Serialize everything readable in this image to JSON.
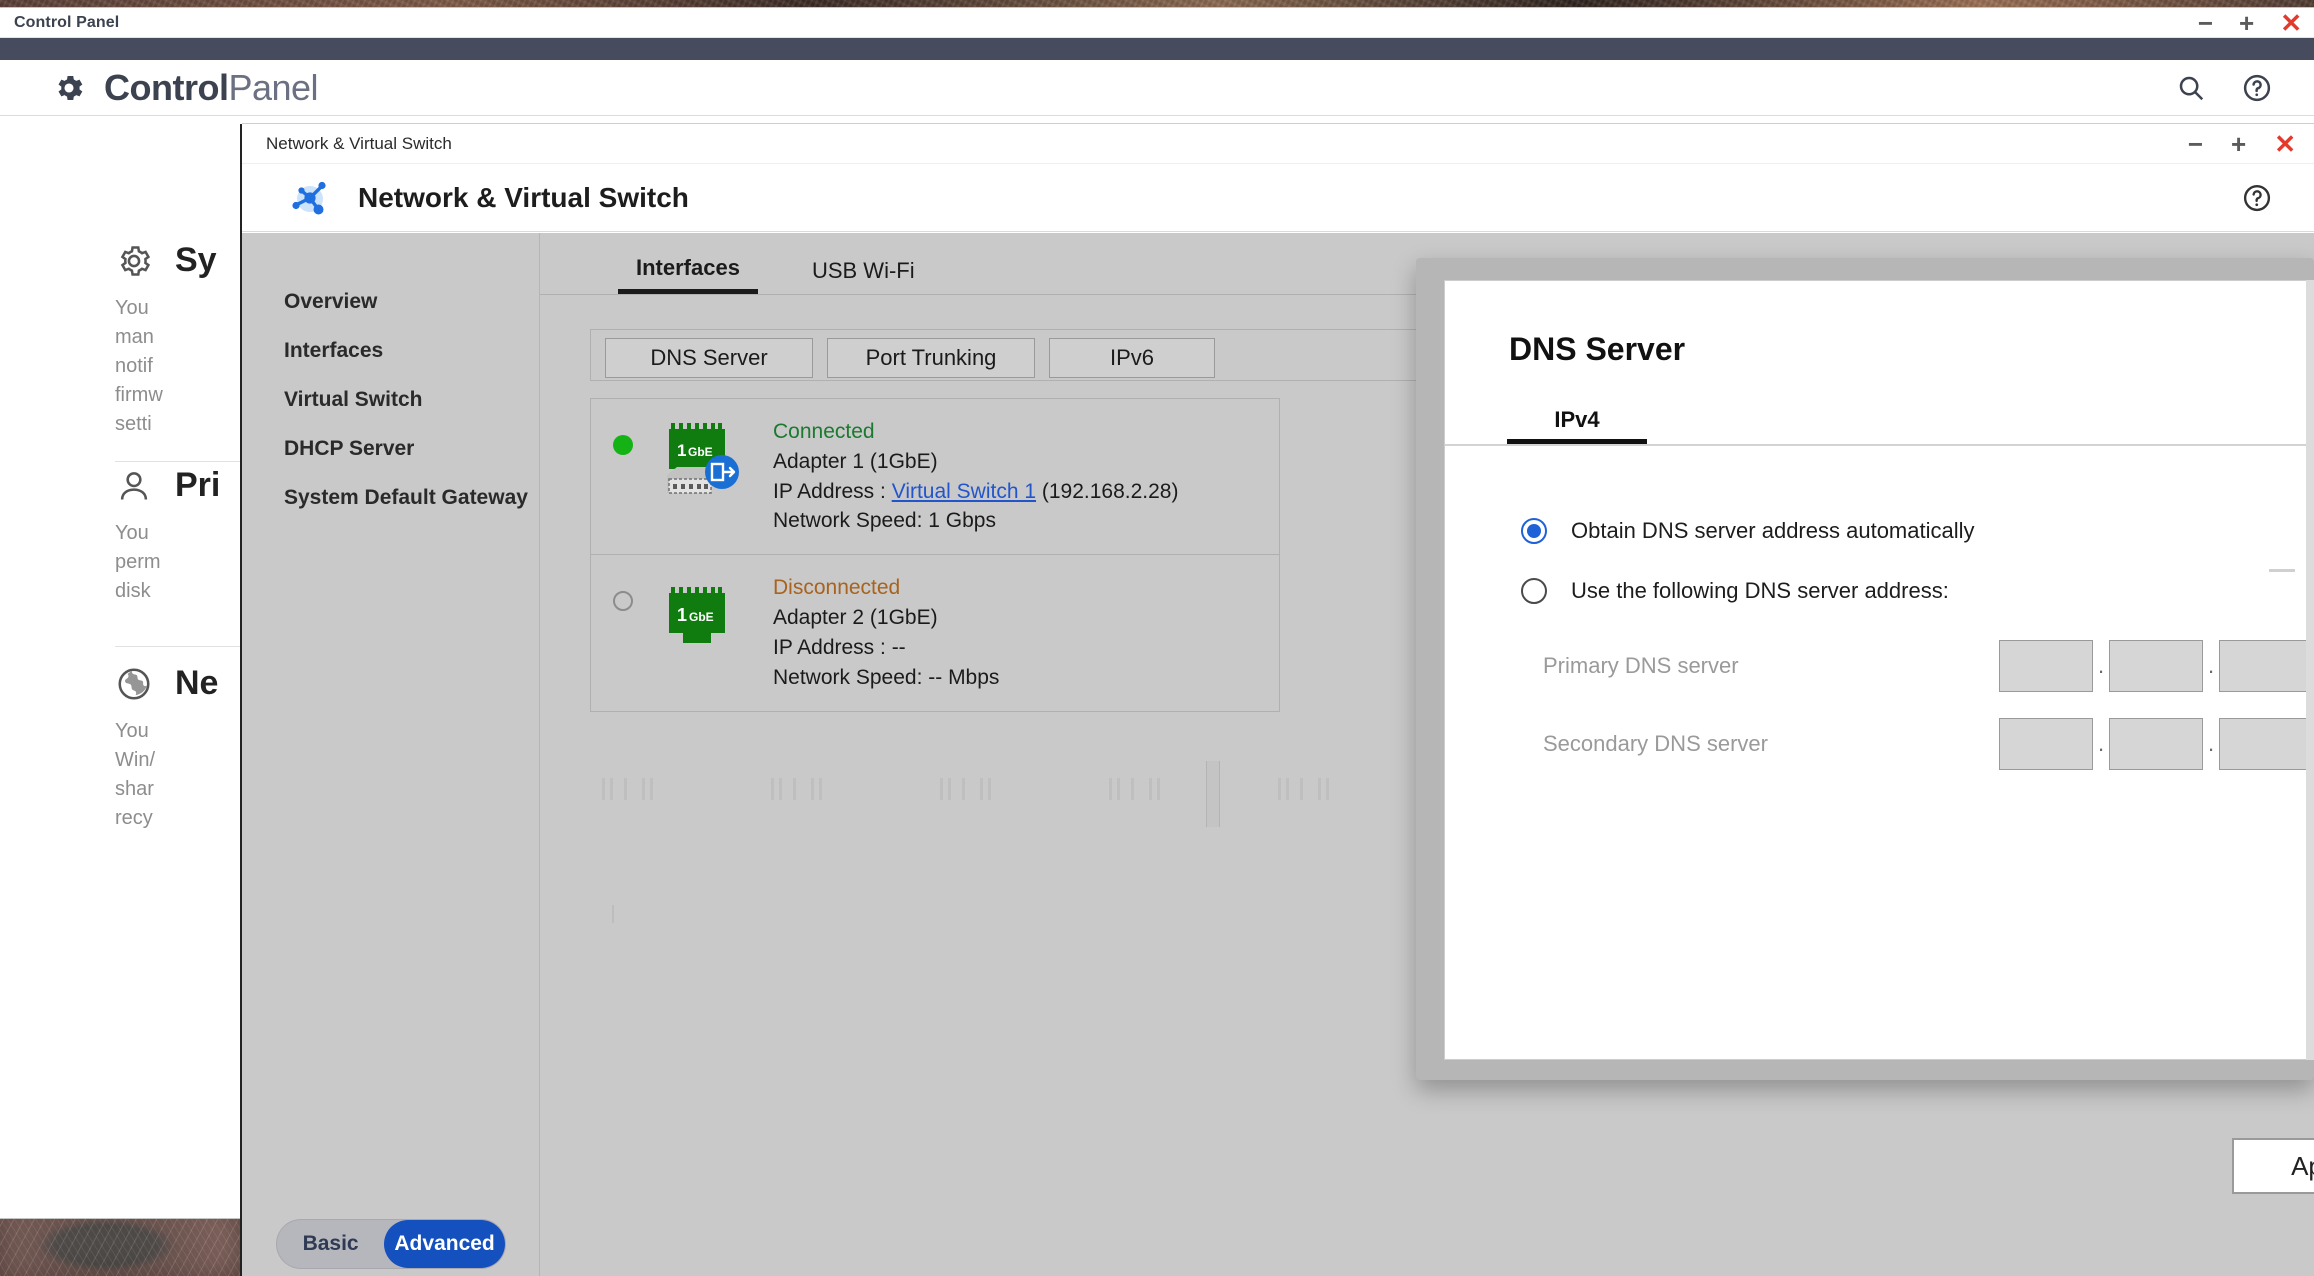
{
  "desktop": {
    "name": "desktop-wallpaper"
  },
  "control_panel": {
    "titlebar": {
      "title": "Control Panel",
      "minimize": "−",
      "maximize": "+",
      "close": "✕"
    },
    "brand": {
      "bold": "Control",
      "light": "Panel"
    },
    "header_icons": {
      "search": "search-icon",
      "help": "help-icon"
    },
    "sections": [
      {
        "icon": "gear-icon",
        "title": "Sy",
        "desc": "You\nman\nnotif\nfirmw\nsetti"
      },
      {
        "icon": "user-icon",
        "title": "Pri",
        "desc": "You\nperm\ndisk"
      },
      {
        "icon": "globe-icon",
        "title": "Ne",
        "desc": "You\nWin/\nshar\nrecy"
      }
    ]
  },
  "nvs_window": {
    "titlebar": {
      "title": "Network & Virtual Switch",
      "minimize": "−",
      "maximize": "+",
      "close": "✕"
    },
    "header": {
      "title": "Network & Virtual Switch",
      "logo": "network-switch-icon",
      "help": "help-icon"
    },
    "sidebar": {
      "items": [
        {
          "label": "Overview"
        },
        {
          "label": "Interfaces"
        },
        {
          "label": "Virtual Switch"
        },
        {
          "label": "DHCP Server"
        },
        {
          "label": "System Default Gateway"
        }
      ],
      "mode_toggle": {
        "basic": "Basic",
        "advanced": "Advanced",
        "selected": "Advanced"
      }
    },
    "tabs": [
      {
        "label": "Interfaces",
        "active": true
      },
      {
        "label": "USB Wi-Fi",
        "active": false
      }
    ],
    "toolbar_buttons": [
      {
        "label": "DNS Server"
      },
      {
        "label": "Port Trunking"
      },
      {
        "label": "IPv6"
      }
    ],
    "adapters": [
      {
        "status": "Connected",
        "status_color": "#1b7a2f",
        "indicator": "status-dot-green",
        "name": "Adapter 1 (1GbE)",
        "nic_badge": "1GbE",
        "ip_label": "IP Address : ",
        "ip_link": "Virtual Switch 1",
        "ip_value": " (192.168.2.28)",
        "speed_label": "Network Speed",
        "speed_value": ": 1 Gbps"
      },
      {
        "status": "Disconnected",
        "status_color": "#a8631d",
        "indicator": "status-ring-grey",
        "name": "Adapter 2 (1GbE)",
        "nic_badge": "1GbE",
        "ip_label": "IP Address : ",
        "ip_link": "",
        "ip_value": "--",
        "speed_label": "Network Speed",
        "speed_value": ": -- Mbps"
      }
    ]
  },
  "dns_dialog": {
    "title": "DNS Server",
    "tabs": [
      {
        "label": "IPv4",
        "active": true
      }
    ],
    "options": [
      {
        "label": "Obtain DNS server address automatically",
        "selected": true
      },
      {
        "label": "Use the following DNS server address:",
        "selected": false
      }
    ],
    "fields": [
      {
        "label": "Primary DNS server",
        "octets": [
          "",
          "",
          "",
          ""
        ],
        "separator": "."
      },
      {
        "label": "Secondary DNS server",
        "octets": [
          "",
          "",
          "",
          ""
        ],
        "separator": "."
      }
    ],
    "apply_button": "Ap",
    "accent_color": "#1f62d8"
  }
}
